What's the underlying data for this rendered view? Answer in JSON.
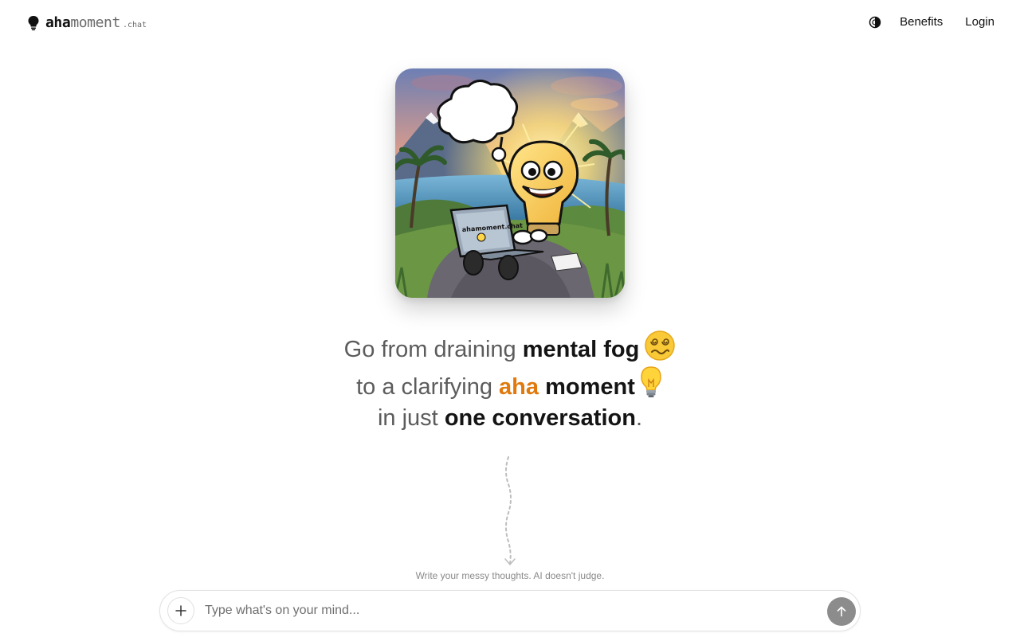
{
  "header": {
    "logo_aha": "aha",
    "logo_moment": "moment",
    "logo_tld": ".chat",
    "nav": {
      "benefits": "Benefits",
      "login": "Login"
    }
  },
  "hero": {
    "image_icon": "lightbulb-character-with-laptop-illustration",
    "laptop_text": "ahamoment.chat"
  },
  "headline": {
    "line1_pre": "Go from draining ",
    "line1_bold": "mental fog",
    "line1_emoji": "dizzy-face",
    "line2_pre": "to a clarifying ",
    "line2_orange": "aha",
    "line2_bold": " moment",
    "line2_emoji": "light-bulb",
    "line3_pre": "in just ",
    "line3_bold": "one conversation",
    "line3_post": "."
  },
  "hint": "Write your messy thoughts. AI doesn't judge.",
  "chat": {
    "placeholder": "Type what's on your mind...",
    "add_icon": "plus-icon",
    "send_icon": "arrow-up-icon"
  },
  "colors": {
    "accent_orange": "#e07a0e",
    "send_button": "#8c8c8c",
    "text_muted": "#5c5c5c"
  }
}
